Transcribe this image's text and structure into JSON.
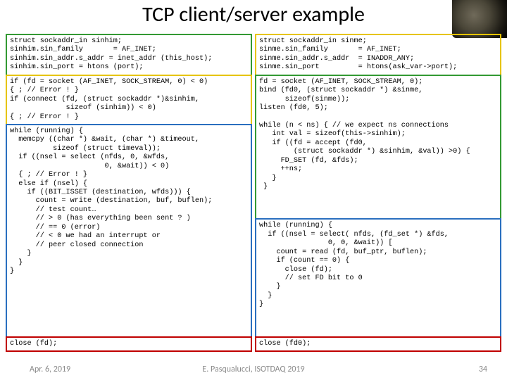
{
  "title": "TCP client/server example",
  "left": {
    "green": "struct sockaddr_in sinhim;\nsinhim.sin_family       = AF_INET;\nsinhim.sin_addr.s_addr = inet_addr (this_host);\nsinhim.sin_port = htons (port);",
    "yellow": "if (fd = socket (AF_INET, SOCK_STREAM, 0) < 0)\n{ ; // Error ! }\nif (connect (fd, (struct sockaddr *)&sinhim,\n             sizeof (sinhim)) < 0)\n{ ; // Error ! }",
    "blue": "while (running) {\n  memcpy ((char *) &wait, (char *) &timeout,\n          sizeof (struct timeval));\n  if ((nsel = select (nfds, 0, &wfds,\n                      0, &wait)) < 0)\n  { ; // Error ! }\n  else if (nsel) {\n    if ((BIT_ISSET (destination, wfds))) {\n      count = write (destination, buf, buflen);\n      // test count…\n      // > 0 (has everything been sent ? )\n      // == 0 (error)\n      // < 0 we had an interrupt or\n      // peer closed connection\n    }\n  }\n}",
    "red": "close (fd);"
  },
  "right": {
    "yellow": "struct sockaddr_in sinme;\nsinme.sin_family       = AF_INET;\nsinme.sin_addr.s_addr  = INADDR_ANY;\nsinme.sin_port         = htons(ask_var->port);",
    "green": "fd = socket (AF_INET, SOCK_STREAM, 0);\nbind (fd0, (struct sockaddr *) &sinme,\n      sizeof(sinme));\nlisten (fd0, 5);\n\nwhile (n < ns) { // we expect ns connections\n   int val = sizeof(this->sinhim);\n   if ((fd = accept (fd0,\n        (struct sockaddr *) &sinhim, &val)) >0) {\n     FD_SET (fd, &fds);\n     ++ns;\n   }\n }",
    "blue": "while (running) {\n  if ((nsel = select( nfds, (fd_set *) &fds,\n                0, 0, &wait)) [\n    count = read (fd, buf_ptr, buflen);\n    if (count == 0) {\n      close (fd);\n      // set FD bit to 0\n    }\n  }\n}",
    "red": "close (fd0);"
  },
  "footer": {
    "date": "Apr. 6, 2019",
    "venue": "E. Pasqualucci, ISOTDAQ 2019",
    "page": "34"
  }
}
